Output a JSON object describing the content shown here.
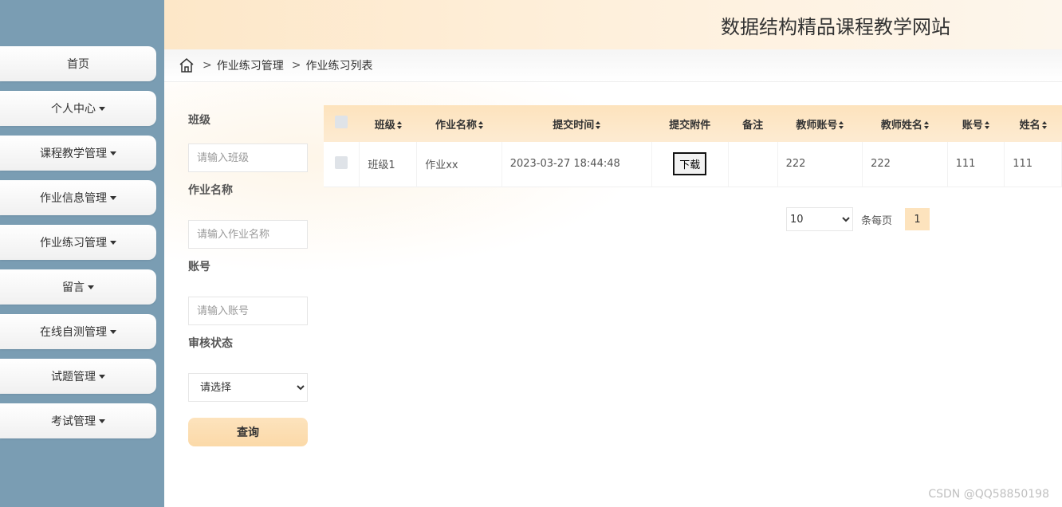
{
  "site": {
    "title": "数据结构精品课程教学网站"
  },
  "sidebar": {
    "items": [
      {
        "label": "首页",
        "has_caret": false
      },
      {
        "label": "个人中心",
        "has_caret": true
      },
      {
        "label": "课程教学管理",
        "has_caret": true
      },
      {
        "label": "作业信息管理",
        "has_caret": true
      },
      {
        "label": "作业练习管理",
        "has_caret": true
      },
      {
        "label": "留言",
        "has_caret": true
      },
      {
        "label": "在线自测管理",
        "has_caret": true
      },
      {
        "label": "试题管理",
        "has_caret": true
      },
      {
        "label": "考试管理",
        "has_caret": true
      }
    ]
  },
  "breadcrumb": {
    "sep": ">",
    "level1": "作业练习管理",
    "level2": "作业练习列表"
  },
  "search": {
    "class_label": "班级",
    "class_placeholder": "请输入班级",
    "name_label": "作业名称",
    "name_placeholder": "请输入作业名称",
    "account_label": "账号",
    "account_placeholder": "请输入账号",
    "status_label": "审核状态",
    "status_selected": "请选择",
    "query_button": "查询"
  },
  "table": {
    "columns": [
      "班级",
      "作业名称",
      "提交时间",
      "提交附件",
      "备注",
      "教师账号",
      "教师姓名",
      "账号",
      "姓名"
    ],
    "sortable": [
      true,
      true,
      true,
      false,
      false,
      true,
      true,
      true,
      true
    ],
    "rows": [
      {
        "class": "班级1",
        "name": "作业xx",
        "time": "2023-03-27 18:44:48",
        "attachment_button": "下载",
        "remark": "",
        "teacher_account": "222",
        "teacher_name": "222",
        "account": "111",
        "student_name": "111"
      }
    ]
  },
  "pagination": {
    "page_size": "10",
    "per_page_label": "条每页",
    "current_page": "1"
  },
  "watermark": "CSDN @QQ58850198"
}
